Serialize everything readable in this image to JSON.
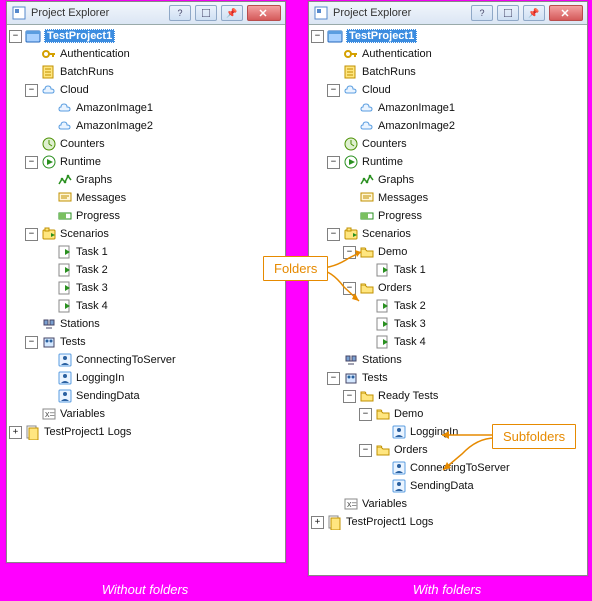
{
  "window_title": "Project Explorer",
  "selected_node": "TestProject1",
  "left_tree": [
    {
      "d": 0,
      "t": "-",
      "i": "project",
      "k": "TestProject1",
      "sel": true
    },
    {
      "d": 1,
      "t": " ",
      "i": "key",
      "k": "Authentication"
    },
    {
      "d": 1,
      "t": " ",
      "i": "batch",
      "k": "BatchRuns"
    },
    {
      "d": 1,
      "t": "-",
      "i": "cloud",
      "k": "Cloud"
    },
    {
      "d": 2,
      "t": " ",
      "i": "cloud",
      "k": "AmazonImage1"
    },
    {
      "d": 2,
      "t": " ",
      "i": "cloud",
      "k": "AmazonImage2"
    },
    {
      "d": 1,
      "t": " ",
      "i": "counter",
      "k": "Counters"
    },
    {
      "d": 1,
      "t": "-",
      "i": "play",
      "k": "Runtime"
    },
    {
      "d": 2,
      "t": " ",
      "i": "graph",
      "k": "Graphs"
    },
    {
      "d": 2,
      "t": " ",
      "i": "msg",
      "k": "Messages"
    },
    {
      "d": 2,
      "t": " ",
      "i": "prog",
      "k": "Progress"
    },
    {
      "d": 1,
      "t": "-",
      "i": "scenario",
      "k": "Scenarios"
    },
    {
      "d": 2,
      "t": " ",
      "i": "task",
      "k": "Task 1"
    },
    {
      "d": 2,
      "t": " ",
      "i": "task",
      "k": "Task 2"
    },
    {
      "d": 2,
      "t": " ",
      "i": "task",
      "k": "Task 3"
    },
    {
      "d": 2,
      "t": " ",
      "i": "task",
      "k": "Task 4"
    },
    {
      "d": 1,
      "t": " ",
      "i": "station",
      "k": "Stations"
    },
    {
      "d": 1,
      "t": "-",
      "i": "tests",
      "k": "Tests"
    },
    {
      "d": 2,
      "t": " ",
      "i": "person",
      "k": "ConnectingToServer"
    },
    {
      "d": 2,
      "t": " ",
      "i": "person",
      "k": "LoggingIn"
    },
    {
      "d": 2,
      "t": " ",
      "i": "person",
      "k": "SendingData"
    },
    {
      "d": 1,
      "t": " ",
      "i": "vars",
      "k": "Variables"
    },
    {
      "d": 0,
      "t": "+",
      "i": "logs",
      "k": "TestProject1 Logs"
    }
  ],
  "right_tree": [
    {
      "d": 0,
      "t": "-",
      "i": "project",
      "k": "TestProject1",
      "sel": true
    },
    {
      "d": 1,
      "t": " ",
      "i": "key",
      "k": "Authentication"
    },
    {
      "d": 1,
      "t": " ",
      "i": "batch",
      "k": "BatchRuns"
    },
    {
      "d": 1,
      "t": "-",
      "i": "cloud",
      "k": "Cloud"
    },
    {
      "d": 2,
      "t": " ",
      "i": "cloud",
      "k": "AmazonImage1"
    },
    {
      "d": 2,
      "t": " ",
      "i": "cloud",
      "k": "AmazonImage2"
    },
    {
      "d": 1,
      "t": " ",
      "i": "counter",
      "k": "Counters"
    },
    {
      "d": 1,
      "t": "-",
      "i": "play",
      "k": "Runtime"
    },
    {
      "d": 2,
      "t": " ",
      "i": "graph",
      "k": "Graphs"
    },
    {
      "d": 2,
      "t": " ",
      "i": "msg",
      "k": "Messages"
    },
    {
      "d": 2,
      "t": " ",
      "i": "prog",
      "k": "Progress"
    },
    {
      "d": 1,
      "t": "-",
      "i": "scenario",
      "k": "Scenarios"
    },
    {
      "d": 2,
      "t": "-",
      "i": "folder",
      "k": "Demo"
    },
    {
      "d": 3,
      "t": " ",
      "i": "task",
      "k": "Task 1"
    },
    {
      "d": 2,
      "t": "-",
      "i": "folder",
      "k": "Orders"
    },
    {
      "d": 3,
      "t": " ",
      "i": "task",
      "k": "Task 2"
    },
    {
      "d": 3,
      "t": " ",
      "i": "task",
      "k": "Task 3"
    },
    {
      "d": 3,
      "t": " ",
      "i": "task",
      "k": "Task 4"
    },
    {
      "d": 1,
      "t": " ",
      "i": "station",
      "k": "Stations"
    },
    {
      "d": 1,
      "t": "-",
      "i": "tests",
      "k": "Tests"
    },
    {
      "d": 2,
      "t": "-",
      "i": "folder",
      "k": "Ready Tests"
    },
    {
      "d": 3,
      "t": "-",
      "i": "folder",
      "k": "Demo"
    },
    {
      "d": 4,
      "t": " ",
      "i": "person",
      "k": "LoggingIn"
    },
    {
      "d": 3,
      "t": "-",
      "i": "folder",
      "k": "Orders"
    },
    {
      "d": 4,
      "t": " ",
      "i": "person",
      "k": "ConnectingToServer"
    },
    {
      "d": 4,
      "t": " ",
      "i": "person",
      "k": "SendingData"
    },
    {
      "d": 1,
      "t": " ",
      "i": "vars",
      "k": "Variables"
    },
    {
      "d": 0,
      "t": "+",
      "i": "logs",
      "k": "TestProject1 Logs"
    }
  ],
  "callouts": {
    "folders": "Folders",
    "subfolders": "Subfolders"
  },
  "captions": {
    "left": "Without folders",
    "right": "With folders"
  },
  "titlebar_buttons": {
    "help": "?",
    "restore": "❐",
    "pin": "📌",
    "close": "✕"
  }
}
